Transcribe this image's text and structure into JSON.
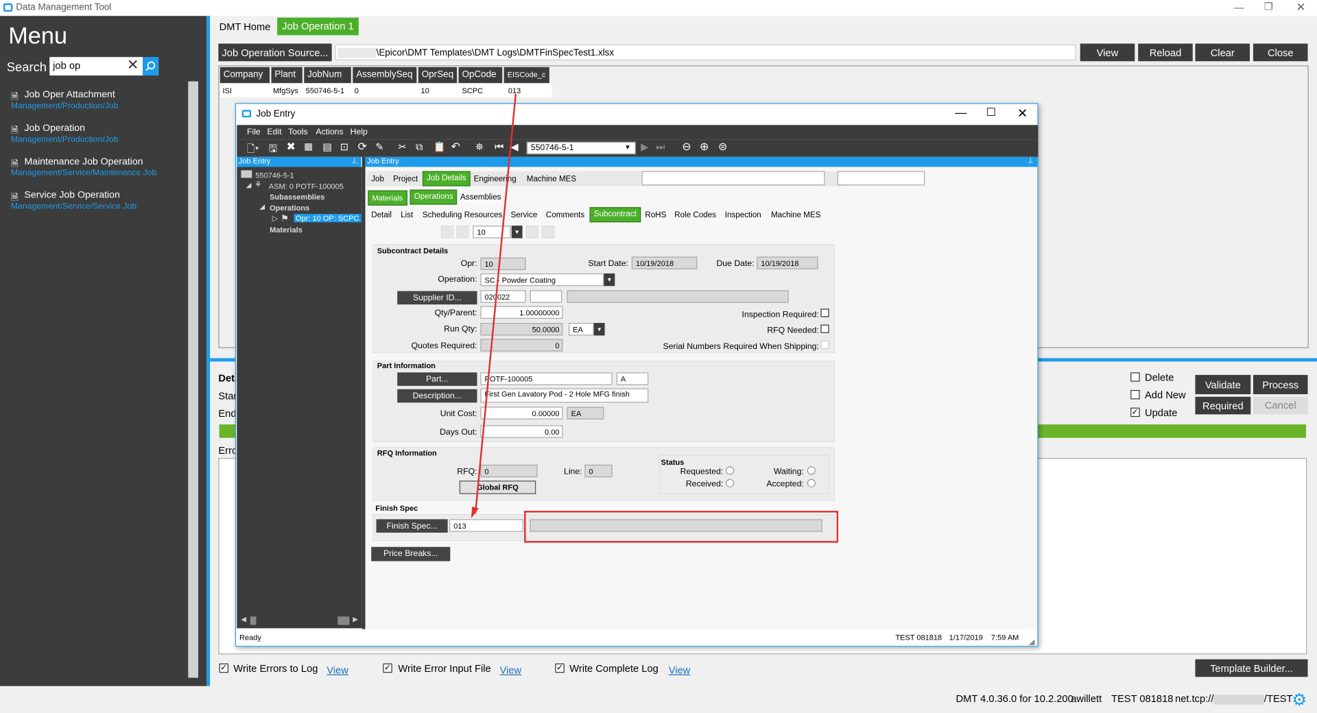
{
  "window": {
    "title": "Data Management Tool"
  },
  "menu": {
    "title": "Menu",
    "search_label": "Search",
    "search_value": "job op",
    "items": [
      {
        "label": "Job Oper Attachment",
        "path": "Management/Production/Job"
      },
      {
        "label": "Job Operation",
        "path": "Management/Production/Job"
      },
      {
        "label": "Maintenance Job Operation",
        "path": "Management/Service/Maintenance Job"
      },
      {
        "label": "Service Job Operation",
        "path": "Management/Service/Service Job"
      }
    ]
  },
  "tabs": [
    "DMT Home",
    "Job Operation 1"
  ],
  "source": {
    "button": "Job Operation Source...",
    "path": "\\Epicor\\DMT Templates\\DMT Logs\\DMTFinSpecTest1.xlsx"
  },
  "top_buttons": [
    "View",
    "Reload",
    "Clear",
    "Close"
  ],
  "grid": {
    "headers": [
      "Company",
      "Plant",
      "JobNum",
      "AssemblySeq",
      "OprSeq",
      "OpCode",
      "EISCode_c"
    ],
    "row": [
      "ISI",
      "MfgSys",
      "550746-5-1",
      "0",
      "10",
      "SCPC",
      "013"
    ]
  },
  "bottom": {
    "detail": "Deta",
    "start": "Start",
    "end": "End",
    "error": "Erro",
    "delete": "Delete",
    "add_new": "Add New",
    "update": "Update",
    "validate": "Validate",
    "process": "Process",
    "required": "Required",
    "cancel": "Cancel",
    "write_errors": "Write Errors to Log",
    "write_error_input": "Write Error Input File",
    "write_complete": "Write Complete Log",
    "view": "View",
    "template_builder": "Template Builder..."
  },
  "status_bar": {
    "version": "DMT 4.0.36.0 for 10.2.200",
    "user": "awillett",
    "db": "TEST 081818",
    "conn_prefix": "net.tcp://",
    "conn_suffix": "/TEST"
  },
  "job_entry": {
    "title": "Job Entry",
    "menu": [
      "File",
      "Edit",
      "Tools",
      "Actions",
      "Help"
    ],
    "job_combo": "550746-5-1",
    "left_header": "Job Entry",
    "right_header": "Job Entry",
    "tree": {
      "root": "550746-5-1",
      "asm": "ASM: 0 POTF-100005",
      "subassemblies": "Subassemblies",
      "operations": "Operations",
      "opr": "Opr: 10 OP: SCPC",
      "materials": "Materials"
    },
    "tabs1": [
      "Job",
      "Project",
      "Job Details",
      "Engineering",
      "Machine MES"
    ],
    "tabs2": [
      "Materials",
      "Operations",
      "Assemblies"
    ],
    "tabs3": [
      "Detail",
      "List",
      "Scheduling Resources",
      "Service",
      "Comments",
      "Subcontract",
      "RoHS",
      "Role Codes",
      "Inspection",
      "Machine MES"
    ],
    "nav_value": "10",
    "subcontract": {
      "header": "Subcontract Details",
      "opr_label": "Opr:",
      "opr": "10",
      "start_label": "Start Date:",
      "start": "10/19/2018",
      "due_label": "Due Date:",
      "due": "10/19/2018",
      "operation_label": "Operation:",
      "operation": "SC - Powder Coating",
      "supplier_btn": "Supplier ID...",
      "supplier": "020022",
      "qty_label": "Qty/Parent:",
      "qty": "1.00000000",
      "run_label": "Run Qty:",
      "run": "50.0000",
      "run_uom": "EA",
      "quotes_label": "Quotes Required:",
      "quotes": "0",
      "insp": "Inspection Required:",
      "rfq_needed": "RFQ Needed:",
      "serial": "Serial Numbers Required When Shipping:"
    },
    "part": {
      "header": "Part Information",
      "part_btn": "Part...",
      "part": "POTF-100005",
      "rev": "A",
      "desc_btn": "Description...",
      "desc": "First Gen Lavatory Pod - 2 Hole MFG finish",
      "cost_label": "Unit Cost:",
      "cost": "0.00000",
      "cost_uom": "EA",
      "days_label": "Days Out:",
      "days": "0.00"
    },
    "rfq": {
      "header": "RFQ Information",
      "rfq_label": "RFQ:",
      "rfq": "0",
      "line_label": "Line:",
      "line": "0",
      "global": "Global RFQ",
      "status": "Status",
      "requested": "Requested:",
      "received": "Received:",
      "waiting": "Waiting:",
      "accepted": "Accepted:"
    },
    "finish": {
      "header": "Finish Spec",
      "btn": "Finish Spec...",
      "value": "013"
    },
    "price_breaks": "Price Breaks...",
    "status": {
      "ready": "Ready",
      "db": "TEST 081818",
      "date": "1/17/2019",
      "time": "7:59 AM"
    }
  },
  "colors": {
    "accent": "#1e9be9",
    "green": "#4caf2a",
    "menu_bg": "#3c3c3c",
    "highlight": "#e03030"
  }
}
